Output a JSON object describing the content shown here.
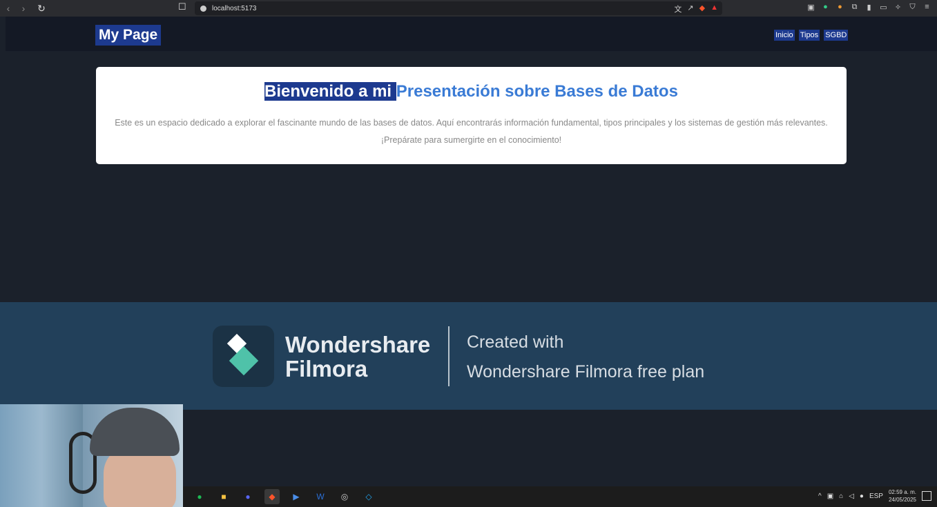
{
  "browser": {
    "url": "localhost:5173",
    "icons": [
      "back-icon",
      "forward-icon",
      "reload-icon",
      "bookmark-icon"
    ],
    "accent_brave": "#fb542b"
  },
  "site": {
    "brand": "My Page",
    "nav": [
      "Inicio",
      "Tipos",
      "SGBD"
    ],
    "title_selected": "Bienvenido a mi ",
    "title_rest": "Presentación sobre Bases de Datos",
    "paragraph1": "Este es un espacio dedicado a explorar el fascinante mundo de las bases de datos. Aquí encontrarás información fundamental, tipos principales y los sistemas de gestión más relevantes.",
    "paragraph2": "¡Prepárate para sumergirte en el conocimiento!",
    "accent": "#3a7bd5",
    "highlight": "#1d3a8f"
  },
  "watermark": {
    "name_line1": "Wondershare",
    "name_line2": "Filmora",
    "text1": "Created with",
    "text2": "Wondershare Filmora free plan"
  },
  "taskbar": {
    "apps": [
      "spotify-icon",
      "file-explorer-icon",
      "discord-icon",
      "brave-icon",
      "powershell-icon",
      "word-icon",
      "app-icon",
      "vscode-icon"
    ],
    "language": "ESP",
    "time": "02:59 a. m.",
    "date": "24/05/2025"
  }
}
